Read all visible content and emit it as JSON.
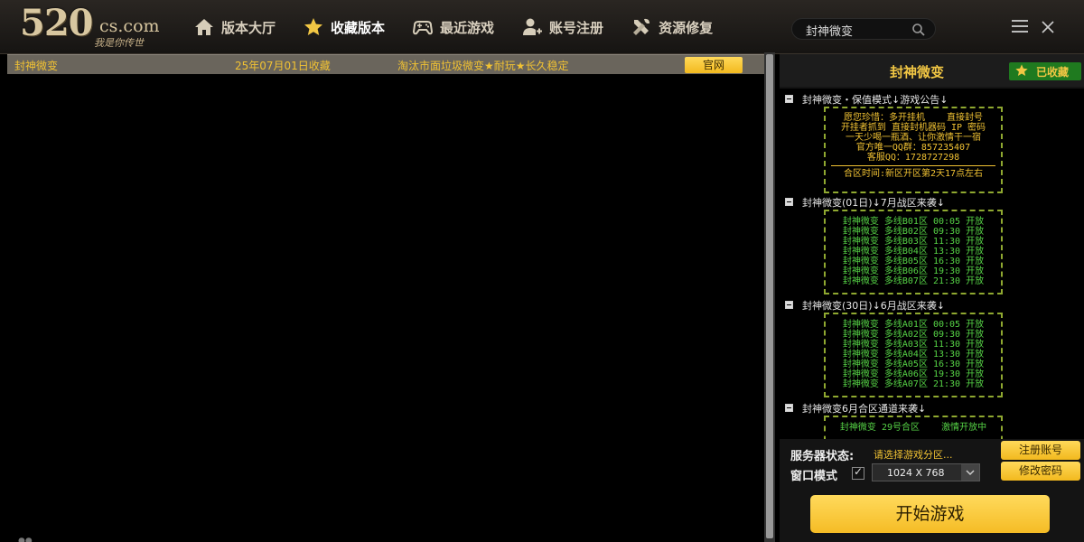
{
  "logo": {
    "number": "520",
    "domain": "cs.com",
    "slogan": "我是你传世"
  },
  "nav": [
    {
      "label": "版本大厅",
      "icon": "home-icon"
    },
    {
      "label": "收藏版本",
      "icon": "star-icon"
    },
    {
      "label": "最近游戏",
      "icon": "gamepad-icon"
    },
    {
      "label": "账号注册",
      "icon": "add-user-icon"
    },
    {
      "label": "资源修复",
      "icon": "tools-icon"
    }
  ],
  "search": {
    "value": "封神微变",
    "icon": "search-icon"
  },
  "list": {
    "rows": [
      {
        "name": "封神微变",
        "date": "25年07月01日收藏",
        "desc": "淘汰市面垃圾微变★耐玩★长久稳定",
        "button": "官网"
      }
    ]
  },
  "panel": {
    "title": "封神微变",
    "fav_label": "已收藏",
    "sections": [
      {
        "head": "封神微变・保值模式↓游戏公告↓",
        "lines": [
          "愿您珍惜：多开挂机    直接封号",
          "开挂者抓到 直接封机器码 IP 密码",
          "一天少喝一瓶酒、让你激情干一宿",
          "官方唯一QQ群：857235407",
          "客服QQ：1728727298",
          "合区时间:新区开区第2天17点左右"
        ]
      },
      {
        "head": "封神微变(01日)↓7月战区来袭↓",
        "lines": [
          "封神微变 多线B01区 00:05 开放",
          "封神微变 多线B02区 09:30 开放",
          "封神微变 多线B03区 11:30 开放",
          "封神微变 多线B04区 13:30 开放",
          "封神微变 多线B05区 16:30 开放",
          "封神微变 多线B06区 19:30 开放",
          "封神微变 多线B07区 21:30 开放"
        ]
      },
      {
        "head": "封神微变(30日)↓6月战区来袭↓",
        "lines": [
          "封神微变 多线A01区 00:05 开放",
          "封神微变 多线A02区 09:30 开放",
          "封神微变 多线A03区 11:30 开放",
          "封神微变 多线A04区 13:30 开放",
          "封神微变 多线A05区 16:30 开放",
          "封神微变 多线A06区 19:30 开放",
          "封神微变 多线A07区 21:30 开放"
        ]
      },
      {
        "head": "封神微变6月合区通道来袭↓",
        "lines": [
          "封神微变 29号合区    激情开放中"
        ]
      }
    ],
    "server_status_label": "服务器状态:",
    "server_status_value": "请选择游戏分区...",
    "window_mode_label": "窗口模式",
    "resolution": "1024 X 768",
    "register_button": "注册账号",
    "change_pw_button": "修改密码",
    "start_button": "开始游戏"
  },
  "colors": {
    "accent": "#f2c744",
    "notice_green": "#56d346",
    "badge_green": "#1f7a1f"
  }
}
